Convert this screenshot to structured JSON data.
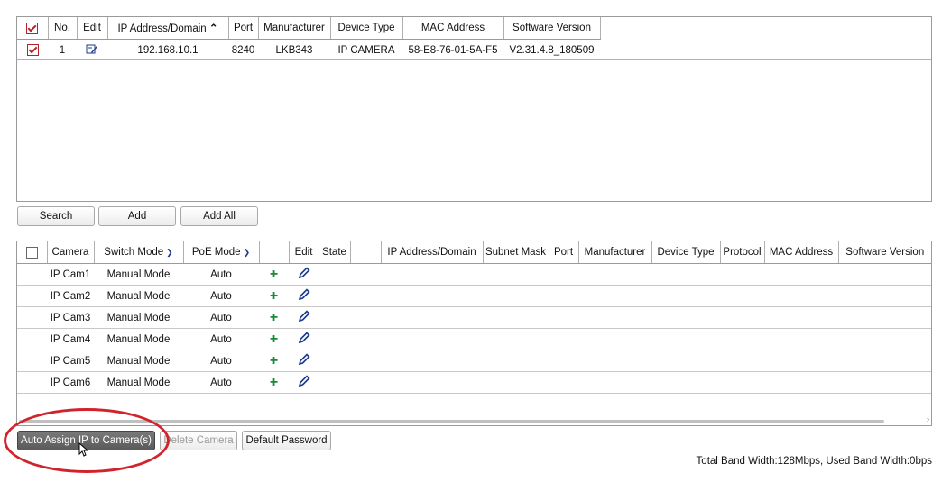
{
  "top_table": {
    "columns": [
      "No.",
      "Edit",
      "IP Address/Domain",
      "Port",
      "Manufacturer",
      "Device Type",
      "MAC Address",
      "Software Version"
    ],
    "sort_indicator": "^",
    "select_all_checked": true,
    "rows": [
      {
        "checked": true,
        "no": "1",
        "ip": "192.168.10.1",
        "port": "8240",
        "manufacturer": "LKB343",
        "device_type": "IP CAMERA",
        "mac": "58-E8-76-01-5A-F5",
        "software": "V2.31.4.8_180509"
      }
    ]
  },
  "top_buttons": {
    "search": "Search",
    "add": "Add",
    "add_all": "Add All"
  },
  "bottom_table": {
    "columns": [
      "Camera",
      "Switch Mode",
      "PoE Mode",
      "",
      "Edit",
      "State",
      "",
      "IP Address/Domain",
      "Subnet Mask",
      "Port",
      "Manufacturer",
      "Device Type",
      "Protocol",
      "MAC Address",
      "Software Version"
    ],
    "rows": [
      {
        "camera": "IP Cam1",
        "switch_mode": "Manual Mode",
        "poe_mode": "Auto"
      },
      {
        "camera": "IP Cam2",
        "switch_mode": "Manual Mode",
        "poe_mode": "Auto"
      },
      {
        "camera": "IP Cam3",
        "switch_mode": "Manual Mode",
        "poe_mode": "Auto"
      },
      {
        "camera": "IP Cam4",
        "switch_mode": "Manual Mode",
        "poe_mode": "Auto"
      },
      {
        "camera": "IP Cam5",
        "switch_mode": "Manual Mode",
        "poe_mode": "Auto"
      },
      {
        "camera": "IP Cam6",
        "switch_mode": "Manual Mode",
        "poe_mode": "Auto"
      }
    ]
  },
  "bottom_buttons": {
    "auto_assign": "Auto Assign IP to Camera(s)",
    "delete_camera": "Delete Camera",
    "default_password": "Default Password"
  },
  "status": {
    "bandwidth": "Total Band Width:128Mbps, Used Band Width:0bps"
  },
  "colors": {
    "checkbox_check": "#c0202a",
    "add_icon": "#1a8a3a",
    "edit_icon": "#1a3a8c",
    "highlight_ellipse": "#d0242c"
  }
}
